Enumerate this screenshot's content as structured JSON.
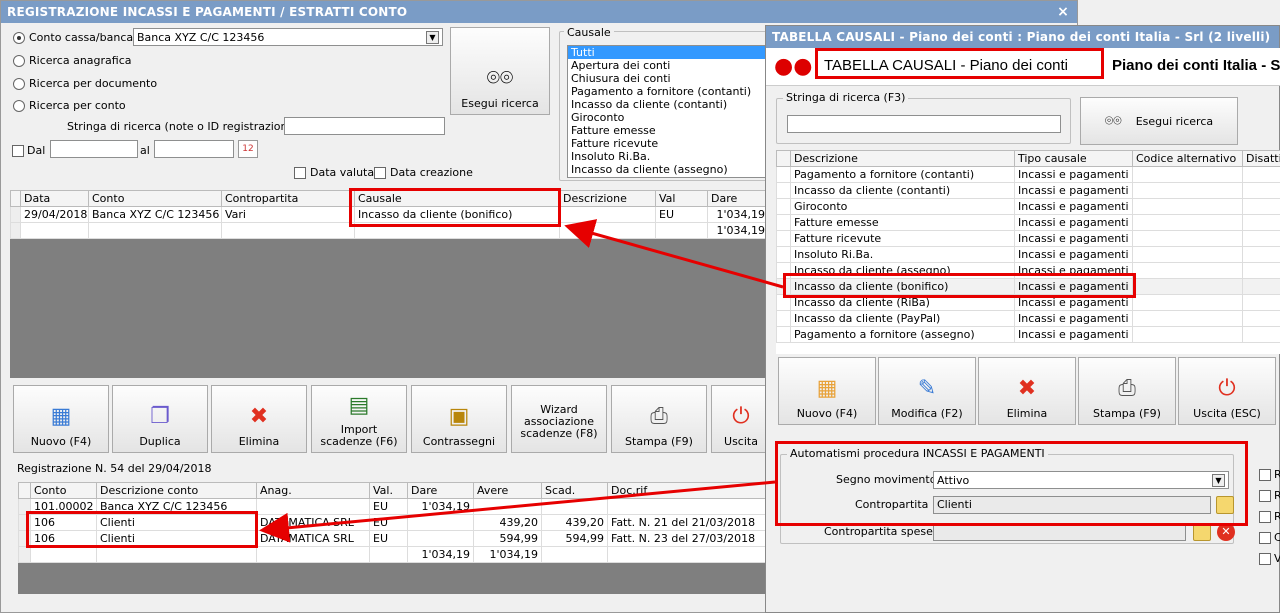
{
  "main": {
    "title": "REGISTRAZIONE INCASSI E PAGAMENTI / ESTRATTI CONTO",
    "close": "×",
    "radios": [
      "Conto cassa/banca",
      "Ricerca anagrafica",
      "Ricerca per documento",
      "Ricerca per conto"
    ],
    "conto_value": "Banca XYZ C/C 123456",
    "search_label": "Stringa di ricerca (note o ID registrazione) :",
    "dal_label": "Dal",
    "al_label": "al",
    "data_valuta": "Data valuta",
    "data_creazione": "Data creazione",
    "search_button": "Esegui ricerca",
    "causale_label": "Causale",
    "causale_items": [
      "Tutti",
      "Apertura dei conti",
      "Chiusura dei conti",
      "Pagamento a fornitore (contanti)",
      "Incasso da cliente (contanti)",
      "Giroconto",
      "Fatture emesse",
      "Fatture ricevute",
      "Insoluto Ri.Ba.",
      "Incasso da cliente (assegno)"
    ],
    "grid1": {
      "headers": [
        "Data",
        "Conto",
        "Contropartita",
        "Causale",
        "Descrizione",
        "Val",
        "Dare"
      ],
      "rows": [
        [
          "29/04/2018",
          "Banca XYZ C/C 123456",
          "Vari",
          "Incasso da cliente (bonifico)",
          "",
          "EU",
          "1'034,19"
        ],
        [
          "",
          "",
          "",
          "",
          "",
          "",
          "1'034,19"
        ]
      ]
    },
    "toolbar": [
      "Nuovo (F4)",
      "Duplica",
      "Elimina",
      "Import scadenze (F6)",
      "Contrassegni",
      "Wizard associazione scadenze (F8)",
      "Stampa (F9)",
      "Uscita"
    ],
    "reg_label": "Registrazione N. 54 del 29/04/2018",
    "grid2": {
      "headers": [
        "Conto",
        "Descrizione conto",
        "Anag.",
        "Val.",
        "Dare",
        "Avere",
        "Scad.",
        "Doc.rif."
      ],
      "rows": [
        [
          "101.00002",
          "Banca XYZ C/C 123456",
          "",
          "EU",
          "1'034,19",
          "",
          "",
          ""
        ],
        [
          "106",
          "Clienti",
          "DATAMATICA SRL",
          "EU",
          "",
          "439,20",
          "439,20",
          "Fatt. N. 21 del 21/03/2018"
        ],
        [
          "106",
          "Clienti",
          "DATAMATICA SRL",
          "EU",
          "",
          "594,99",
          "594,99",
          "Fatt. N. 23 del 27/03/2018"
        ],
        [
          "",
          "",
          "",
          "",
          "1'034,19",
          "1'034,19",
          "",
          ""
        ]
      ]
    }
  },
  "popup": {
    "title": "TABELLA CAUSALI - Piano dei conti : Piano dei conti Italia - Srl (2 livelli)",
    "banner_title": "TABELLA CAUSALI - Piano dei conti",
    "banner_sub": "Piano dei conti Italia - S",
    "search_label": "Stringa di ricerca (F3)",
    "search_button": "Esegui ricerca",
    "grid": {
      "headers": [
        "Descrizione",
        "Tipo causale",
        "Codice alternativo",
        "Disattiv"
      ],
      "rows": [
        [
          "Pagamento a fornitore (contanti)",
          "Incassi e pagamenti"
        ],
        [
          "Incasso da cliente (contanti)",
          "Incassi e pagamenti"
        ],
        [
          "Giroconto",
          "Incassi e pagamenti"
        ],
        [
          "Fatture emesse",
          "Incassi e pagamenti"
        ],
        [
          "Fatture ricevute",
          "Incassi e pagamenti"
        ],
        [
          "Insoluto Ri.Ba.",
          "Incassi e pagamenti"
        ],
        [
          "Incasso da cliente (assegno)",
          "Incassi e pagamenti"
        ],
        [
          "Incasso da cliente (bonifico)",
          "Incassi e pagamenti"
        ],
        [
          "Incasso da cliente (RiBa)",
          "Incassi e pagamenti"
        ],
        [
          "Incasso da cliente (PayPal)",
          "Incassi e pagamenti"
        ],
        [
          "Pagamento a fornitore (assegno)",
          "Incassi e pagamenti"
        ]
      ]
    },
    "toolbar": [
      "Nuovo (F4)",
      "Modifica (F2)",
      "Elimina",
      "Stampa (F9)",
      "Uscita (ESC)"
    ],
    "auto_title": "Automatismi procedura INCASSI E PAGAMENTI",
    "segno_label": "Segno movimento :",
    "segno_value": "Attivo",
    "contro_label": "Contropartita :",
    "contro_value": "Clienti",
    "spese_label": "Contropartita spese :",
    "side_checks": [
      "R",
      "R",
      "R",
      "C",
      "V"
    ]
  },
  "colors": {
    "accent": "#7a9cc6",
    "highlight": "#e60000",
    "selection": "#3399ff"
  }
}
